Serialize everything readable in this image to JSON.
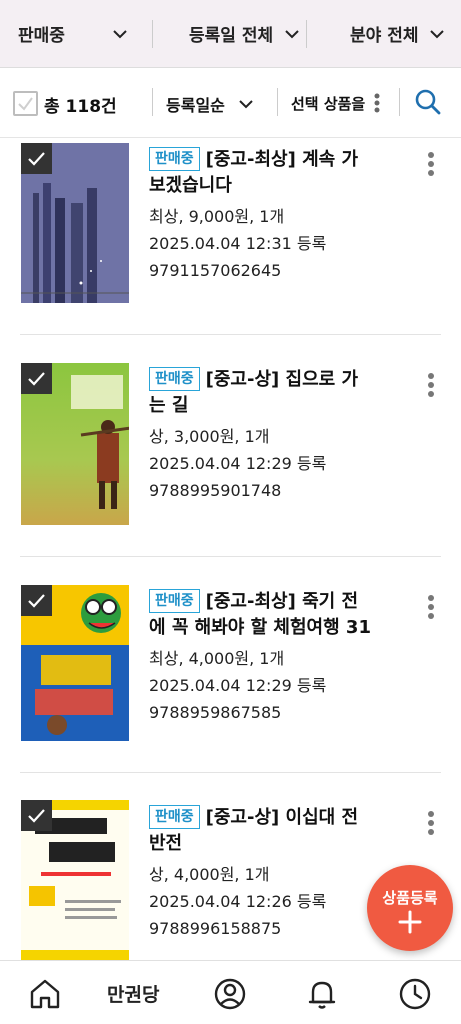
{
  "filters": {
    "status": "판매중",
    "date": "등록일 전체",
    "field": "분야 전체"
  },
  "sortbar": {
    "total": "총 118건",
    "sort": "등록일순",
    "bulk": "선택 상품을"
  },
  "items": [
    {
      "badge": "판매중",
      "title": "[중고-최상] 계속 가보겠습니다",
      "title_line1": "[중고-최상] 계속 가",
      "title_line2": "보겠습니다",
      "price": "최상, 9,000원, 1개",
      "date": "2025.04.04 12:31 등록",
      "isbn": "9791157062645"
    },
    {
      "badge": "판매중",
      "title": "[중고-상] 집으로 가는 길",
      "title_line1": "[중고-상] 집으로 가",
      "title_line2": "는 길",
      "price": "상, 3,000원, 1개",
      "date": "2025.04.04 12:29 등록",
      "isbn": "9788995901748"
    },
    {
      "badge": "판매중",
      "title": "[중고-최상] 죽기 전에 꼭 해봐야 할 체험여행 31",
      "title_line1": "[중고-최상] 죽기 전",
      "title_line2": "에 꼭 해봐야 할 체험여행 31",
      "price": "최상, 4,000원, 1개",
      "date": "2025.04.04 12:29 등록",
      "isbn": "9788959867585"
    },
    {
      "badge": "판매중",
      "title": "[중고-상] 이십대 전반전",
      "title_line1": "[중고-상] 이십대 전",
      "title_line2": "반전",
      "price": "상, 4,000원, 1개",
      "date": "2025.04.04 12:26 등록",
      "isbn": "9788996158875"
    }
  ],
  "fab": {
    "label": "상품등록"
  },
  "bottom_nav": {
    "brand": "만권당",
    "icons": [
      "home-icon",
      "user-icon",
      "bell-icon",
      "clock-icon"
    ]
  },
  "colors": {
    "accent": "#f05a41",
    "badge": "#29a4d8",
    "search": "#1f6fae"
  }
}
